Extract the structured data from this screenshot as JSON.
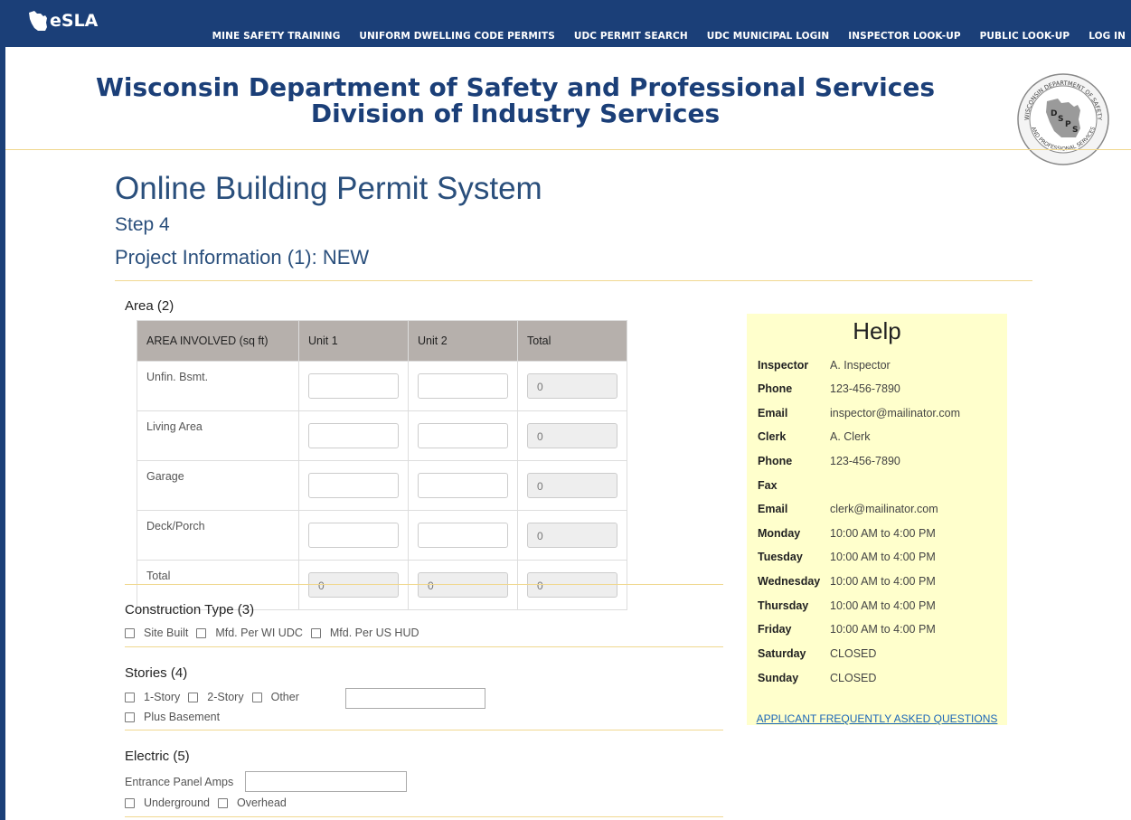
{
  "nav": {
    "logo_text": "eSLA",
    "links": [
      "MINE SAFETY TRAINING",
      "UNIFORM DWELLING CODE PERMITS",
      "UDC PERMIT SEARCH",
      "UDC MUNICIPAL LOGIN",
      "INSPECTOR LOOK-UP",
      "PUBLIC LOOK-UP",
      "LOG IN"
    ]
  },
  "header": {
    "line1": "Wisconsin Department of Safety and Professional Services",
    "line2": "Division of Industry Services",
    "seal": {
      "top": "DEPARTMENT OF SAFETY",
      "bottom": "AND PROFESSIONAL SERVICES",
      "left": "WISCONSIN",
      "letters": "DSPS"
    }
  },
  "page": {
    "title": "Online Building Permit System",
    "step": "Step 4",
    "project": "Project Information (1): NEW"
  },
  "area": {
    "title": "Area (2)",
    "headers": [
      "AREA INVOLVED (sq ft)",
      "Unit 1",
      "Unit 2",
      "Total"
    ],
    "rows": [
      {
        "label": "Unfin. Bsmt.",
        "unit1": "",
        "unit2": "",
        "total": "0"
      },
      {
        "label": "Living Area",
        "unit1": "",
        "unit2": "",
        "total": "0"
      },
      {
        "label": "Garage",
        "unit1": "",
        "unit2": "",
        "total": "0"
      },
      {
        "label": "Deck/Porch",
        "unit1": "",
        "unit2": "",
        "total": "0"
      },
      {
        "label": "Total",
        "unit1": "0",
        "unit2": "0",
        "total": "0"
      }
    ]
  },
  "construction": {
    "title": "Construction Type (3)",
    "options": [
      "Site Built",
      "Mfd. Per WI UDC",
      "Mfd. Per US HUD"
    ]
  },
  "stories": {
    "title": "Stories (4)",
    "options": [
      "1-Story",
      "2-Story",
      "Other"
    ],
    "other_value": "",
    "basement": "Plus Basement"
  },
  "electric": {
    "title": "Electric (5)",
    "amps_label": "Entrance Panel Amps",
    "amps_value": "",
    "options": [
      "Underground",
      "Overhead"
    ]
  },
  "help": {
    "title": "Help",
    "rows": [
      {
        "k": "Inspector",
        "v": "A. Inspector"
      },
      {
        "k": "Phone",
        "v": "123-456-7890"
      },
      {
        "k": "Email",
        "v": "inspector@mailinator.com"
      },
      {
        "k": "Clerk",
        "v": "A. Clerk"
      },
      {
        "k": "Phone",
        "v": " 123-456-7890"
      },
      {
        "k": "Fax",
        "v": ""
      },
      {
        "k": "Email",
        "v": "clerk@mailinator.com"
      },
      {
        "k": "Monday",
        "v": "10:00 AM  to  4:00 PM"
      },
      {
        "k": "Tuesday",
        "v": "10:00 AM  to  4:00 PM"
      },
      {
        "k": "Wednesday",
        "v": "10:00 AM  to  4:00 PM"
      },
      {
        "k": "Thursday",
        "v": "10:00 AM  to  4:00 PM"
      },
      {
        "k": "Friday",
        "v": "10:00 AM  to  4:00 PM"
      },
      {
        "k": "Saturday",
        "v": "  CLOSED"
      },
      {
        "k": "Sunday",
        "v": "  CLOSED"
      }
    ],
    "faq": "APPLICANT FREQUENTLY ASKED QUESTIONS"
  },
  "colors": {
    "nav": "#1b3f78",
    "accent_rule": "#f0d890",
    "help_bg": "#ffffcc",
    "table_header": "#b6b0ac"
  }
}
